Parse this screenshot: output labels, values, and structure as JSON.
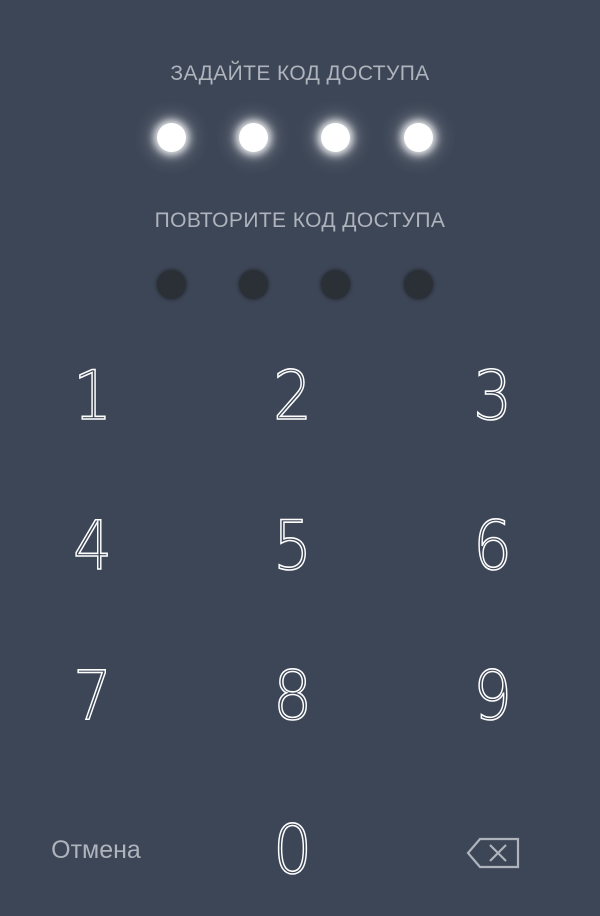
{
  "prompts": {
    "set_code": "ЗАДАЙТЕ КОД ДОСТУПА",
    "repeat_code": "ПОВТОРИТЕ КОД ДОСТУПА"
  },
  "passcode": {
    "length": 4,
    "entered_first": 4,
    "entered_second": 0
  },
  "keypad": {
    "k1": "1",
    "k2": "2",
    "k3": "3",
    "k4": "4",
    "k5": "5",
    "k6": "6",
    "k7": "7",
    "k8": "8",
    "k9": "9",
    "k0": "0"
  },
  "actions": {
    "cancel_label": "Отмена",
    "delete_icon": "backspace-icon"
  },
  "colors": {
    "background": "#3d4657",
    "prompt_text": "#aeb3bc",
    "dot_filled": "#ffffff",
    "dot_empty": "#2b2f36",
    "key_text": "#ffffff"
  }
}
